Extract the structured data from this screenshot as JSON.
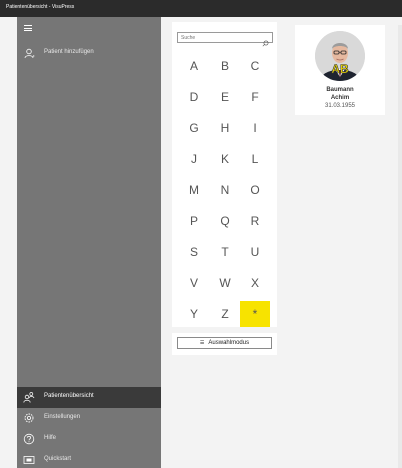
{
  "window": {
    "title": "Patientenübersicht - VisuPress"
  },
  "sidebar": {
    "top_items": [
      {
        "label": "Patient hinzufügen",
        "icon": "person-icon"
      }
    ],
    "bottom_items": [
      {
        "label": "Patientenübersicht",
        "icon": "people-icon",
        "active": true
      },
      {
        "label": "Einstellungen",
        "icon": "gear-icon"
      },
      {
        "label": "Hilfe",
        "icon": "help-icon"
      },
      {
        "label": "Quickstart",
        "icon": "quickstart-icon"
      }
    ]
  },
  "search": {
    "placeholder": "Suche"
  },
  "letters": [
    "A",
    "B",
    "C",
    "D",
    "E",
    "F",
    "G",
    "H",
    "I",
    "J",
    "K",
    "L",
    "M",
    "N",
    "O",
    "P",
    "Q",
    "R",
    "S",
    "T",
    "U",
    "V",
    "W",
    "X",
    "Y",
    "Z",
    "*"
  ],
  "selected_letter": "*",
  "mode_button": {
    "label": "Auswahlmodus"
  },
  "patients": [
    {
      "last_name": "Baumann",
      "first_name": "Achim",
      "dob": "31.03.1955",
      "initials": "AB"
    }
  ],
  "colors": {
    "accent": "#f7e300",
    "sidebar": "#767676",
    "titlebar": "#2b2b2b"
  }
}
